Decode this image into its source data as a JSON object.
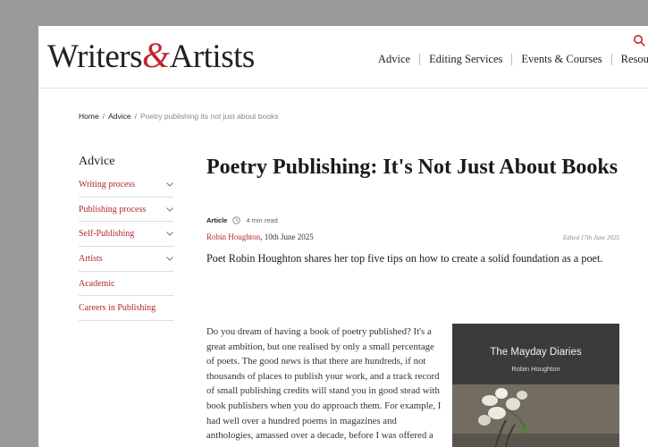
{
  "header": {
    "logo": {
      "part1": "Writers",
      "amp": "&",
      "part2": "Artists"
    },
    "nav": [
      "Advice",
      "Editing Services",
      "Events & Courses",
      "Resources"
    ]
  },
  "breadcrumb": {
    "home": "Home",
    "section": "Advice",
    "current": "Poetry publishing its not just about books"
  },
  "sidebar": {
    "title": "Advice",
    "items": [
      {
        "label": "Writing process",
        "expandable": true
      },
      {
        "label": "Publishing process",
        "expandable": true
      },
      {
        "label": "Self-Publishing",
        "expandable": true
      },
      {
        "label": "Artists",
        "expandable": true
      },
      {
        "label": "Academic",
        "expandable": false
      },
      {
        "label": "Careers in Publishing",
        "expandable": false
      }
    ]
  },
  "article": {
    "title": "Poetry Publishing: It's Not Just About Books",
    "type": "Article",
    "read_time": "4 min read",
    "author": "Robin Houghton",
    "date": ", 10th June 2025",
    "edited": "Edited 17th June 2025",
    "intro": "Poet Robin Houghton shares her top five tips on how to create a solid foundation as a poet.",
    "body": "Do you dream of having a book of poetry published? It's a great ambition, but one realised by only a small percentage of poets. The good news is that there are hundreds, if not thousands of places to publish your work, and a track record of small publishing credits will stand you in good stead with book publishers when you do approach them. For example, I had well over a hundred poems in magazines and anthologies, amassed over a decade, before I was offered a book"
  },
  "book_cover": {
    "title": "The Mayday Diaries",
    "author": "Robin Houghton"
  },
  "colors": {
    "accent": "#b3272d",
    "backdrop": "#9a9a9a",
    "cover_bg": "#3b3b3b"
  }
}
